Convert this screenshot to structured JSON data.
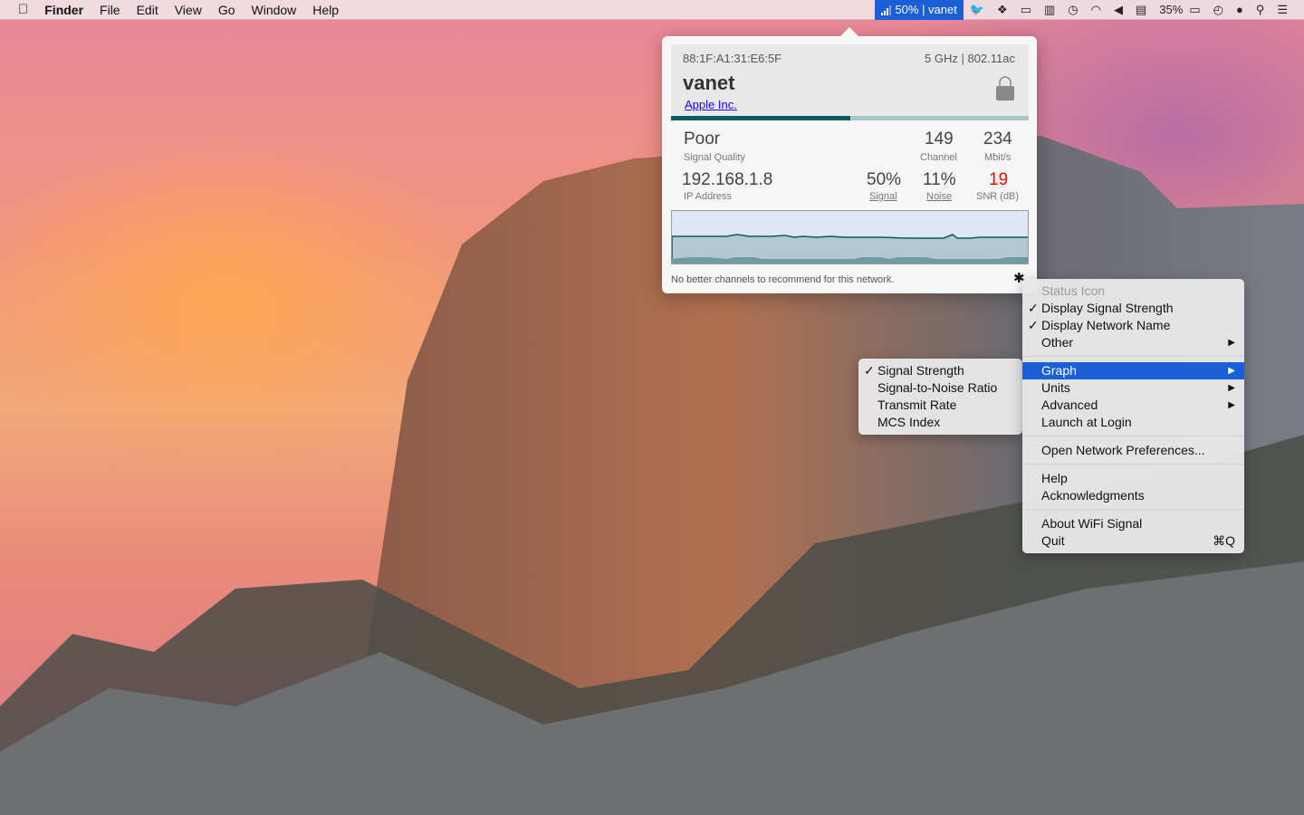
{
  "menubar": {
    "app": "Finder",
    "items": [
      "File",
      "Edit",
      "View",
      "Go",
      "Window",
      "Help"
    ],
    "wifi_status": "50% | vanet",
    "battery": "35%",
    "status_icons": [
      "twitter-icon",
      "dropbox-icon",
      "airplay-icon",
      "memory-icon",
      "time-machine-icon",
      "wifi-icon",
      "volume-icon",
      "flag-us-icon",
      "battery-icon",
      "clock-icon",
      "user-icon",
      "spotlight-icon",
      "notification-center-icon"
    ]
  },
  "popover": {
    "bssid": "88:1F:A1:31:E6:5F",
    "band": "5 GHz | 802.11ac",
    "ssid": "vanet",
    "vendor": "Apple Inc.",
    "signal_quality_fraction": 0.5,
    "quality": "Poor",
    "quality_label": "Signal Quality",
    "channel": "149",
    "channel_label": "Channel",
    "rate": "234",
    "rate_label": "Mbit/s",
    "ip": "192.168.1.8",
    "ip_label": "IP Address",
    "signal": "50%",
    "signal_label": "Signal",
    "noise": "11%",
    "noise_label": "Noise",
    "snr": "19",
    "snr_label": "SNR (dB)",
    "footer": "No better channels to recommend for this network.",
    "colors": {
      "accent": "#0b5b60",
      "snr": "#ff0000",
      "link": "#1a00ff"
    }
  },
  "menu": {
    "status_header": "Status Icon",
    "items1": [
      "Display Signal Strength",
      "Display Network Name",
      "Other"
    ],
    "items2": [
      "Graph",
      "Units",
      "Advanced",
      "Launch at Login"
    ],
    "open_prefs": "Open Network Preferences...",
    "help": "Help",
    "ack": "Acknowledgments",
    "about": "About WiFi Signal",
    "quit": "Quit",
    "quit_shortcut": "⌘Q"
  },
  "submenu": {
    "items": [
      "Signal Strength",
      "Signal-to-Noise Ratio",
      "Transmit Rate",
      "MCS Index"
    ]
  }
}
